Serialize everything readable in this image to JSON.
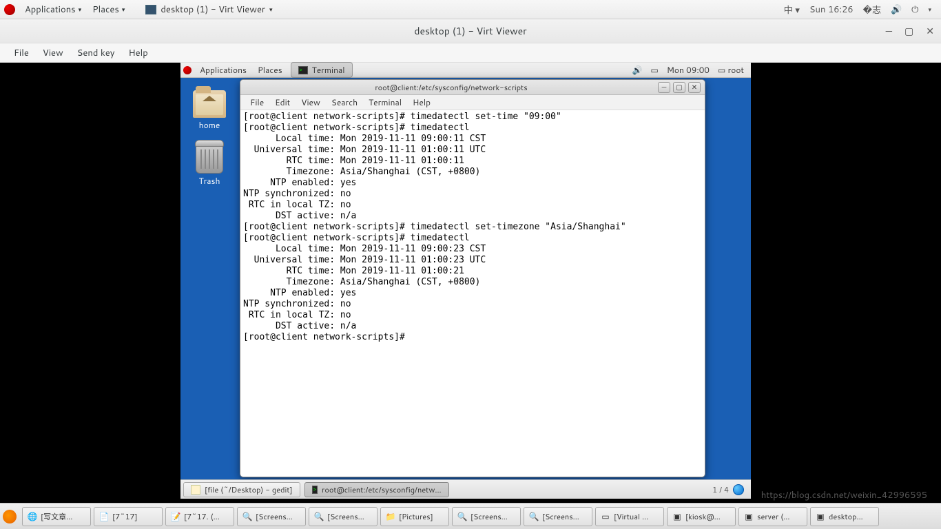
{
  "outer_panel": {
    "applications": "Applications",
    "places": "Places",
    "center_tab": "desktop (1) - Virt Viewer",
    "ime": "中",
    "clock": "Sun 16:26"
  },
  "viewer": {
    "title": "desktop (1) - Virt Viewer",
    "menu": {
      "file": "File",
      "view": "View",
      "sendkey": "Send key",
      "help": "Help"
    }
  },
  "inner_panel": {
    "applications": "Applications",
    "places": "Places",
    "active_task": "Terminal",
    "clock": "Mon 09:00",
    "user": "root"
  },
  "desktop_icons": {
    "home": "home",
    "trash": "Trash"
  },
  "terminal": {
    "title": "root@client:/etc/sysconfig/network-scripts",
    "menu": {
      "file": "File",
      "edit": "Edit",
      "view": "View",
      "search": "Search",
      "terminal": "Terminal",
      "help": "Help"
    },
    "lines": [
      "[root@client network-scripts]# timedatectl set-time \"09:00\"",
      "[root@client network-scripts]# timedatectl",
      "      Local time: Mon 2019-11-11 09:00:11 CST",
      "  Universal time: Mon 2019-11-11 01:00:11 UTC",
      "        RTC time: Mon 2019-11-11 01:00:11",
      "        Timezone: Asia/Shanghai (CST, +0800)",
      "     NTP enabled: yes",
      "NTP synchronized: no",
      " RTC in local TZ: no",
      "      DST active: n/a",
      "[root@client network-scripts]# timedatectl set-timezone \"Asia/Shanghai\"",
      "[root@client network-scripts]# timedatectl",
      "      Local time: Mon 2019-11-11 09:00:23 CST",
      "  Universal time: Mon 2019-11-11 01:00:23 UTC",
      "        RTC time: Mon 2019-11-11 01:00:21",
      "        Timezone: Asia/Shanghai (CST, +0800)",
      "     NTP enabled: yes",
      "NTP synchronized: no",
      " RTC in local TZ: no",
      "      DST active: n/a",
      "[root@client network-scripts]# "
    ]
  },
  "inner_taskbar": {
    "tasks": [
      {
        "label": "[file (~/Desktop) - gedit]"
      },
      {
        "label": "root@client:/etc/sysconfig/netw..."
      }
    ],
    "workspace": "1 / 4"
  },
  "outer_taskbar": {
    "tasks": [
      {
        "label": "[写文章..."
      },
      {
        "label": "[7~17]"
      },
      {
        "label": "[7~17. (..."
      },
      {
        "label": "[Screens..."
      },
      {
        "label": "[Screens..."
      },
      {
        "label": "[Pictures]"
      },
      {
        "label": "[Screens..."
      },
      {
        "label": "[Screens..."
      },
      {
        "label": "[Virtual ..."
      },
      {
        "label": "[kiosk@..."
      },
      {
        "label": "server (..."
      },
      {
        "label": "desktop..."
      }
    ]
  },
  "watermark": "https://blog.csdn.net/weixin_42996595",
  "page_indicator": "1 / 4"
}
